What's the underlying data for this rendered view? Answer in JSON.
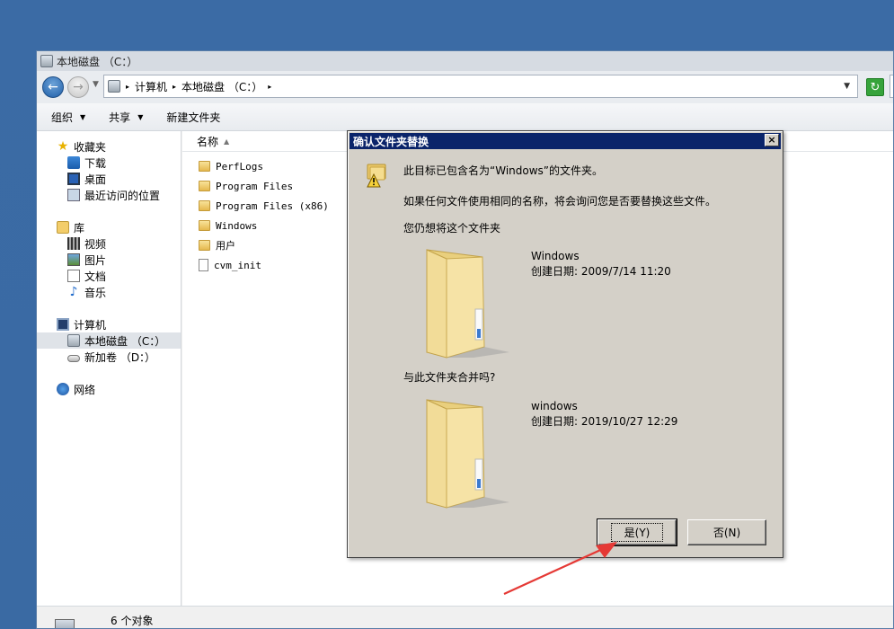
{
  "window": {
    "title": "本地磁盘 （C：）"
  },
  "address": {
    "segments": [
      "计算机",
      "本地磁盘 （C：）"
    ]
  },
  "toolbar": {
    "organize": "组织",
    "share": "共享",
    "new_folder": "新建文件夹"
  },
  "navpane": {
    "favorites": {
      "label": "收藏夹",
      "items": [
        "下载",
        "桌面",
        "最近访问的位置"
      ]
    },
    "libraries": {
      "label": "库",
      "items": [
        "视频",
        "图片",
        "文档",
        "音乐"
      ]
    },
    "computer": {
      "label": "计算机",
      "items": [
        "本地磁盘 （C：）",
        "新加卷 （D：）"
      ],
      "selected_index": 0
    },
    "network": {
      "label": "网络"
    }
  },
  "content": {
    "column_name": "名称",
    "files": [
      {
        "name": "PerfLogs",
        "type": "folder"
      },
      {
        "name": "Program Files",
        "type": "folder"
      },
      {
        "name": "Program Files (x86)",
        "type": "folder"
      },
      {
        "name": "Windows",
        "type": "folder"
      },
      {
        "name": "用户",
        "type": "folder"
      },
      {
        "name": "cvm_init",
        "type": "file"
      }
    ]
  },
  "status": {
    "count_text": "6 个对象"
  },
  "dialog": {
    "title": "确认文件夹替换",
    "line1": "此目标已包含名为“Windows”的文件夹。",
    "line2": "如果任何文件使用相同的名称，将会询问您是否要替换这些文件。",
    "line3": "您仍想将这个文件夹",
    "existing": {
      "name": "Windows",
      "date": "创建日期: 2009/7/14 11:20"
    },
    "merge_question": "与此文件夹合并吗?",
    "incoming": {
      "name": "windows",
      "date": "创建日期: 2019/10/27 12:29"
    },
    "yes_label": "是(Y)",
    "no_label": "否(N)",
    "close_glyph": "×"
  },
  "colors": {
    "title_bar": "#0a246a",
    "desktop": "#3a6ea5",
    "arrow": "#e53935"
  }
}
